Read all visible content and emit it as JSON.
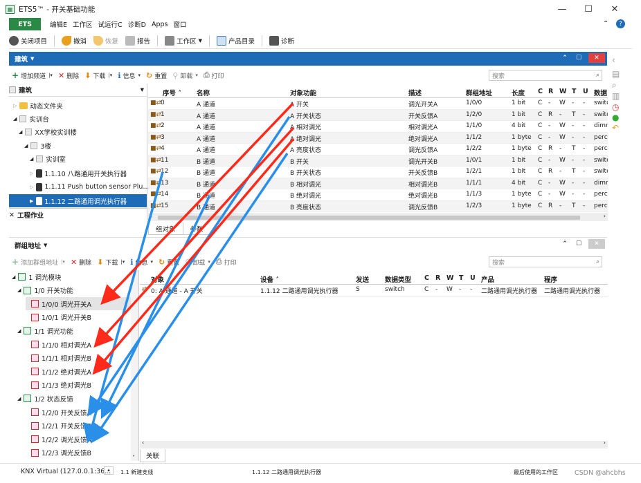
{
  "window": {
    "title": "ETS5™ - 开关基础功能"
  },
  "menu": {
    "ets": "ETS",
    "items": [
      "编辑E",
      "工作区",
      "试运行C",
      "诊断D",
      "Apps",
      "窗口"
    ]
  },
  "toolbar": {
    "close_project": "关闭项目",
    "undo": "撤消",
    "redo": "恢复",
    "report": "报告",
    "workspace": "工作区",
    "catalog": "产品目录",
    "diagnostics": "诊断"
  },
  "building_panel": {
    "title": "建筑",
    "tools": {
      "add_channel": "增加频道",
      "delete": "删除",
      "download": "下载",
      "info": "信息",
      "reset": "重置",
      "unload": "卸载",
      "print": "打印"
    },
    "search_placeholder": "搜索",
    "tree_header": "建筑",
    "tree": [
      "动态文件夹",
      "实训台",
      "XX学校实训楼",
      "3楼",
      "实训室",
      "1.1.10 八路通用开关执行器",
      "1.1.11 Push button sensor Plu...",
      "1.1.12 二路通用调光执行器"
    ],
    "work_section": "工程作业",
    "columns": [
      "序号",
      "名称",
      "对象功能",
      "描述",
      "群组地址",
      "长度",
      "C",
      "R",
      "W",
      "T",
      "U",
      "数据"
    ],
    "rows": [
      {
        "no": "0",
        "name": "A 通道",
        "func": "A 开关",
        "desc": "调光开关A",
        "ga": "1/0/0",
        "len": "1 bit",
        "c": "C",
        "r": "-",
        "w": "W",
        "t": "-",
        "u": "-",
        "dt": "switc"
      },
      {
        "no": "1",
        "name": "A 通道",
        "func": "A 开关状态",
        "desc": "开关反馈A",
        "ga": "1/2/0",
        "len": "1 bit",
        "c": "C",
        "r": "R",
        "w": "-",
        "t": "T",
        "u": "-",
        "dt": "switc"
      },
      {
        "no": "2",
        "name": "A 通道",
        "func": "A 相对调光",
        "desc": "相对调光A",
        "ga": "1/1/0",
        "len": "4 bit",
        "c": "C",
        "r": "-",
        "w": "W",
        "t": "-",
        "u": "-",
        "dt": "dimr"
      },
      {
        "no": "3",
        "name": "A 通道",
        "func": "A 绝对调光",
        "desc": "绝对调光A",
        "ga": "1/1/2",
        "len": "1 byte",
        "c": "C",
        "r": "-",
        "w": "W",
        "t": "-",
        "u": "-",
        "dt": "perc"
      },
      {
        "no": "4",
        "name": "A 通道",
        "func": "A 亮度状态",
        "desc": "调光反馈A",
        "ga": "1/2/2",
        "len": "1 byte",
        "c": "C",
        "r": "R",
        "w": "-",
        "t": "T",
        "u": "-",
        "dt": "perc"
      },
      {
        "no": "11",
        "name": "B 通道",
        "func": "B 开关",
        "desc": "调光开关B",
        "ga": "1/0/1",
        "len": "1 bit",
        "c": "C",
        "r": "-",
        "w": "W",
        "t": "-",
        "u": "-",
        "dt": "switc"
      },
      {
        "no": "12",
        "name": "B 通道",
        "func": "B 开关状态",
        "desc": "开关反馈B",
        "ga": "1/2/1",
        "len": "1 bit",
        "c": "C",
        "r": "R",
        "w": "-",
        "t": "T",
        "u": "-",
        "dt": "switc"
      },
      {
        "no": "13",
        "name": "B 通道",
        "func": "B 相对调光",
        "desc": "相对调光B",
        "ga": "1/1/1",
        "len": "4 bit",
        "c": "C",
        "r": "-",
        "w": "W",
        "t": "-",
        "u": "-",
        "dt": "dimr"
      },
      {
        "no": "14",
        "name": "B 通道",
        "func": "B 绝对调光",
        "desc": "绝对调光B",
        "ga": "1/1/3",
        "len": "1 byte",
        "c": "C",
        "r": "-",
        "w": "W",
        "t": "-",
        "u": "-",
        "dt": "perc"
      },
      {
        "no": "15",
        "name": "B 通道",
        "func": "B 亮度状态",
        "desc": "调光反馈B",
        "ga": "1/2/3",
        "len": "1 byte",
        "c": "C",
        "r": "R",
        "w": "-",
        "t": "T",
        "u": "-",
        "dt": "perc"
      }
    ],
    "bottom_tabs": [
      "组对象",
      "参数"
    ]
  },
  "ga_panel": {
    "title": "群组地址",
    "tools": {
      "add_ga": "添加群组地址",
      "delete": "删除",
      "download": "下载",
      "info": "信息",
      "reset": "重置",
      "unload": "卸载",
      "print": "打印"
    },
    "search_placeholder": "搜索",
    "tree": [
      {
        "label": "1 调光模块",
        "level": 0,
        "kind": "green"
      },
      {
        "label": "1/0 开关功能",
        "level": 1,
        "kind": "green"
      },
      {
        "label": "1/0/0 调光开关A",
        "level": 2,
        "kind": "red",
        "selected": true
      },
      {
        "label": "1/0/1 调光开关B",
        "level": 2,
        "kind": "red"
      },
      {
        "label": "1/1 调光功能",
        "level": 1,
        "kind": "green"
      },
      {
        "label": "1/1/0 相对调光A",
        "level": 2,
        "kind": "red"
      },
      {
        "label": "1/1/1 相对调光B",
        "level": 2,
        "kind": "red"
      },
      {
        "label": "1/1/2 绝对调光A",
        "level": 2,
        "kind": "red"
      },
      {
        "label": "1/1/3 绝对调光B",
        "level": 2,
        "kind": "red"
      },
      {
        "label": "1/2 状态反馈",
        "level": 1,
        "kind": "green"
      },
      {
        "label": "1/2/0 开关反馈A",
        "level": 2,
        "kind": "red"
      },
      {
        "label": "1/2/1 开关反馈B",
        "level": 2,
        "kind": "red"
      },
      {
        "label": "1/2/2 调光反馈A",
        "level": 2,
        "kind": "red"
      },
      {
        "label": "1/2/3 调光反馈B",
        "level": 2,
        "kind": "red"
      }
    ],
    "columns": [
      "对象",
      "设备",
      "发送",
      "数据类型",
      "C",
      "R",
      "W",
      "T",
      "U",
      "产品",
      "程序"
    ],
    "rows": [
      {
        "obj": "0: A 通道 - A 开关",
        "dev": "1.1.12 二路通用调光执行器",
        "send": "S",
        "dtype": "switch",
        "c": "C",
        "r": "-",
        "w": "W",
        "t": "-",
        "u": "-",
        "prod": "二路通用调光执行器",
        "prog": "二路通用调光执行器"
      }
    ],
    "bottom_tab": "关联"
  },
  "statusbar": {
    "connection": "KNX Virtual (127.0.0.1:36...",
    "line": "1.1 新建支线",
    "device": "1.1.12 二路通用调光执行器",
    "workspace": "最后使用的工作区",
    "watermark": "CSDN @ahcbhs"
  },
  "colors": {
    "accent": "#1e6bb8",
    "ets_green": "#2a8a45",
    "arrow_red": "#ff2a1a",
    "arrow_blue": "#2a8fe8"
  }
}
